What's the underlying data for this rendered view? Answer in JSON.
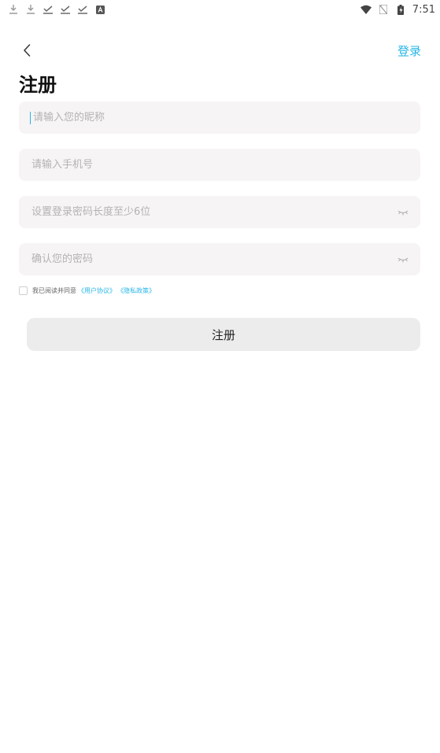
{
  "status_bar": {
    "time": "7:51",
    "left_icons": [
      "download-icon",
      "download-icon",
      "check-icon",
      "check-icon",
      "check-icon",
      "app-notification-icon"
    ],
    "right_icons": [
      "wifi-icon",
      "no-sim-icon",
      "battery-charging-icon"
    ]
  },
  "header": {
    "login_label": "登录",
    "title": "注册"
  },
  "form": {
    "nickname_placeholder": "请输入您的昵称",
    "phone_placeholder": "请输入手机号",
    "password_placeholder": "设置登录密码长度至少6位",
    "confirm_password_placeholder": "确认您的密码"
  },
  "agreement": {
    "prefix": "我已阅读并同意",
    "user_agreement": "《用户协议》",
    "privacy_policy": "《隐私政策》"
  },
  "register_button_label": "注册",
  "colors": {
    "accent": "#26b6e6",
    "field_bg": "#f7f4f6",
    "button_bg": "#ececec"
  }
}
